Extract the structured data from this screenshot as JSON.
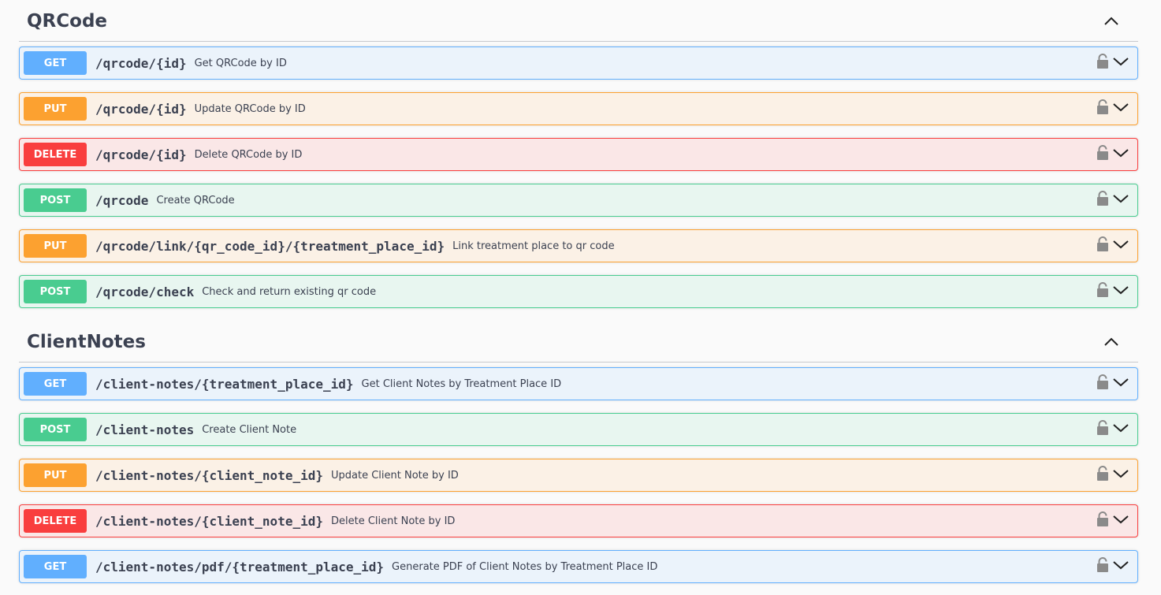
{
  "sections": [
    {
      "title": "QRCode",
      "operations": [
        {
          "method": "GET",
          "path": "/qrcode/{id}",
          "summary": "Get QRCode by ID"
        },
        {
          "method": "PUT",
          "path": "/qrcode/{id}",
          "summary": "Update QRCode by ID"
        },
        {
          "method": "DELETE",
          "path": "/qrcode/{id}",
          "summary": "Delete QRCode by ID"
        },
        {
          "method": "POST",
          "path": "/qrcode",
          "summary": "Create QRCode"
        },
        {
          "method": "PUT",
          "path": "/qrcode/link/{qr_code_id}/{treatment_place_id}",
          "summary": "Link treatment place to qr code"
        },
        {
          "method": "POST",
          "path": "/qrcode/check",
          "summary": "Check and return existing qr code"
        }
      ]
    },
    {
      "title": "ClientNotes",
      "operations": [
        {
          "method": "GET",
          "path": "/client-notes/{treatment_place_id}",
          "summary": "Get Client Notes by Treatment Place ID"
        },
        {
          "method": "POST",
          "path": "/client-notes",
          "summary": "Create Client Note"
        },
        {
          "method": "PUT",
          "path": "/client-notes/{client_note_id}",
          "summary": "Update Client Note by ID"
        },
        {
          "method": "DELETE",
          "path": "/client-notes/{client_note_id}",
          "summary": "Delete Client Note by ID"
        },
        {
          "method": "GET",
          "path": "/client-notes/pdf/{treatment_place_id}",
          "summary": "Generate PDF of Client Notes by Treatment Place ID"
        }
      ]
    }
  ],
  "icons": {
    "lock": "lock-icon",
    "expand": "chevron-down-icon",
    "collapse": "chevron-up-icon"
  },
  "colors": {
    "get": "#61affe",
    "put": "#fca130",
    "delete": "#f93e3e",
    "post": "#49cc90",
    "text": "#3b4151"
  }
}
